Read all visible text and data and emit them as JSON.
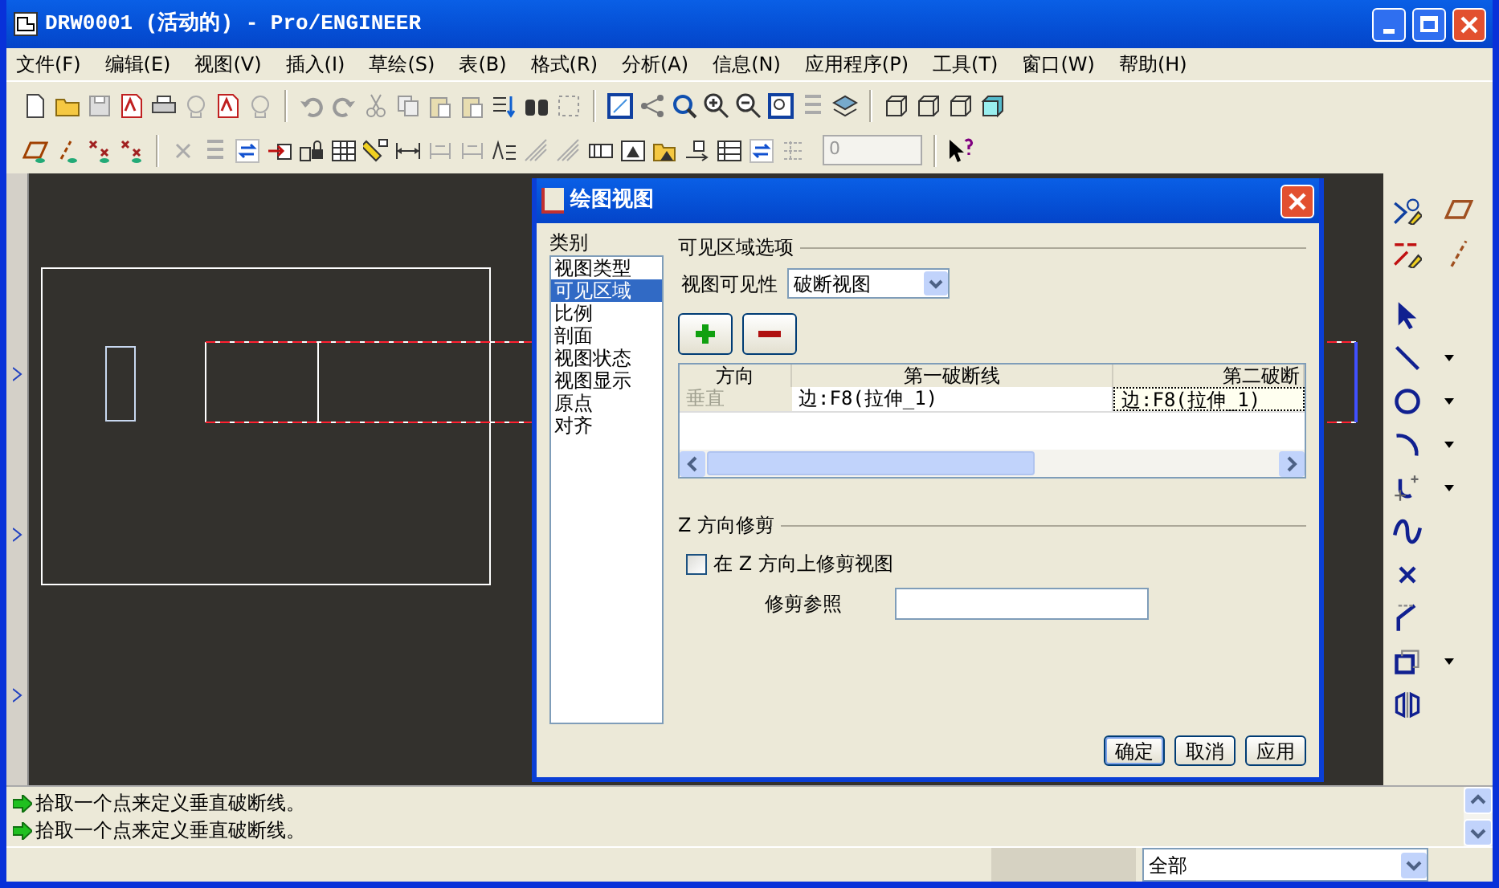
{
  "window": {
    "title": "DRW0001 (活动的) - Pro/ENGINEER"
  },
  "menu": [
    {
      "label": "文件(F)"
    },
    {
      "label": "编辑(E)"
    },
    {
      "label": "视图(V)"
    },
    {
      "label": "插入(I)"
    },
    {
      "label": "草绘(S)"
    },
    {
      "label": "表(B)"
    },
    {
      "label": "格式(R)"
    },
    {
      "label": "分析(A)"
    },
    {
      "label": "信息(N)"
    },
    {
      "label": "应用程序(P)"
    },
    {
      "label": "工具(T)"
    },
    {
      "label": "窗口(W)"
    },
    {
      "label": "帮助(H)"
    }
  ],
  "toolbar": {
    "spin_value": "0"
  },
  "dialog": {
    "title": "绘图视图",
    "category_label": "类别",
    "categories": [
      {
        "label": "视图类型",
        "selected": false
      },
      {
        "label": "可见区域",
        "selected": true
      },
      {
        "label": "比例",
        "selected": false
      },
      {
        "label": "剖面",
        "selected": false
      },
      {
        "label": "视图状态",
        "selected": false
      },
      {
        "label": "视图显示",
        "selected": false
      },
      {
        "label": "原点",
        "selected": false
      },
      {
        "label": "对齐",
        "selected": false
      }
    ],
    "section_title": "可见区域选项",
    "visibility_label": "视图可见性",
    "visibility_value": "破断视图",
    "table": {
      "columns": [
        "方向",
        "第一破断线",
        "第二破断"
      ],
      "rows": [
        {
          "cells": [
            "垂直",
            "边:F8(拉伸_1)",
            "边:F8(拉伸_1)"
          ]
        }
      ]
    },
    "z_section_title": "Z 方向修剪",
    "trim_checkbox": {
      "label": "在 Z 方向上修剪视图",
      "checked": false
    },
    "trim_ref_label": "修剪参照",
    "buttons": [
      "确定",
      "取消",
      "应用"
    ]
  },
  "messages": [
    "拾取一个点来定义垂直破断线。",
    "拾取一个点来定义垂直破断线。"
  ],
  "status_bar": {
    "filter": "全部"
  }
}
